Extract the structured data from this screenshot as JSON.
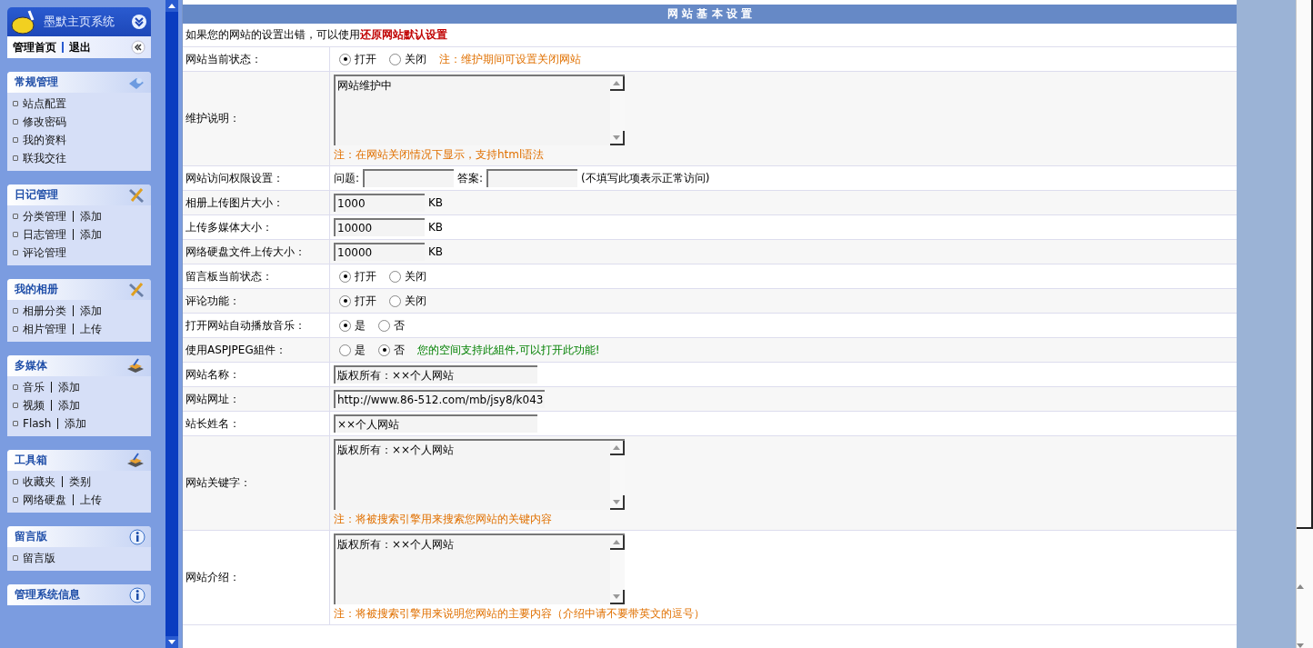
{
  "sidebar": {
    "title": "墨默主页系统",
    "nav": [
      "管理首页",
      "退出"
    ],
    "sections": [
      {
        "title": "常规管理",
        "items": [
          [
            "站点配置"
          ],
          [
            "修改密码"
          ],
          [
            "我的资料"
          ],
          [
            "联我交往"
          ]
        ]
      },
      {
        "title": "日记管理",
        "items": [
          [
            "分类管理",
            "添加"
          ],
          [
            "日志管理",
            "添加"
          ],
          [
            "评论管理"
          ]
        ]
      },
      {
        "title": "我的相册",
        "items": [
          [
            "相册分类",
            "添加"
          ],
          [
            "相片管理",
            "上传"
          ]
        ]
      },
      {
        "title": "多媒体",
        "items": [
          [
            "音乐",
            "添加"
          ],
          [
            "视频",
            "添加"
          ],
          [
            "Flash",
            "添加"
          ]
        ]
      },
      {
        "title": "工具箱",
        "items": [
          [
            "收藏夹",
            "类别"
          ],
          [
            "网络硬盘",
            "上传"
          ]
        ]
      },
      {
        "title": "留言版",
        "items": [
          [
            "留言版"
          ]
        ]
      },
      {
        "title": "管理系统信息"
      }
    ]
  },
  "form": {
    "title": "网 站 基 本 设 置",
    "notice": "如果您的网站的设置出错，可以使用",
    "restore_link": "还原网站默认设置",
    "rows": [
      {
        "kind": "radio",
        "label": "网站当前状态：",
        "options": [
          {
            "label": "打开",
            "selected": true
          },
          {
            "label": "关闭",
            "selected": false
          }
        ],
        "note": {
          "kind": "warning",
          "text": "注：维护期间可设置关闭网站"
        }
      },
      {
        "kind": "textarea",
        "label": "维护说明：",
        "value": "网站维护中",
        "note": "注：在网站关闭情况下显示，支持html语法"
      },
      {
        "kind": "access",
        "label": "网站访问权限设置：",
        "question_label": "问题:",
        "answer_label": "答案:",
        "hint": "(不填写此项表示正常访问)"
      },
      {
        "kind": "size",
        "label": "相册上传图片大小：",
        "value": "1000",
        "unit": "KB"
      },
      {
        "kind": "size",
        "label": "上传多媒体大小：",
        "value": "10000",
        "unit": "KB"
      },
      {
        "kind": "size",
        "label": "网络硬盘文件上传大小：",
        "value": "10000",
        "unit": "KB"
      },
      {
        "kind": "radio",
        "label": "留言板当前状态：",
        "options": [
          {
            "label": "打开",
            "selected": true
          },
          {
            "label": "关闭",
            "selected": false
          }
        ]
      },
      {
        "kind": "radio",
        "label": "评论功能：",
        "options": [
          {
            "label": "打开",
            "selected": true
          },
          {
            "label": "关闭",
            "selected": false
          }
        ]
      },
      {
        "kind": "radio",
        "label": "打开网站自动播放音乐：",
        "options": [
          {
            "label": "是",
            "selected": true
          },
          {
            "label": "否",
            "selected": false
          }
        ]
      },
      {
        "kind": "radio",
        "label": "使用ASPJPEG組件：",
        "options": [
          {
            "label": "是",
            "selected": false
          },
          {
            "label": "否",
            "selected": true
          }
        ],
        "note": {
          "kind": "success",
          "text": "您的空间支持此組件,可以打开此功能!"
        }
      },
      {
        "kind": "text",
        "label": "网站名称：",
        "value": "版权所有：××个人网站"
      },
      {
        "kind": "text",
        "label": "网站网址：",
        "value": "http://www.86-512.com/mb/jsy8/k043"
      },
      {
        "kind": "text",
        "label": "站长姓名：",
        "value": "××个人网站"
      },
      {
        "kind": "textarea",
        "label": "网站关键字：",
        "value": "版权所有：××个人网站",
        "note": "注：将被搜索引擎用来搜索您网站的关键内容"
      },
      {
        "kind": "textarea",
        "label": "网站介绍：",
        "value": "版权所有：××个人网站",
        "note": "注：将被搜索引擎用来说明您网站的主要内容（介绍中请不要带英文的逗号）"
      }
    ]
  }
}
